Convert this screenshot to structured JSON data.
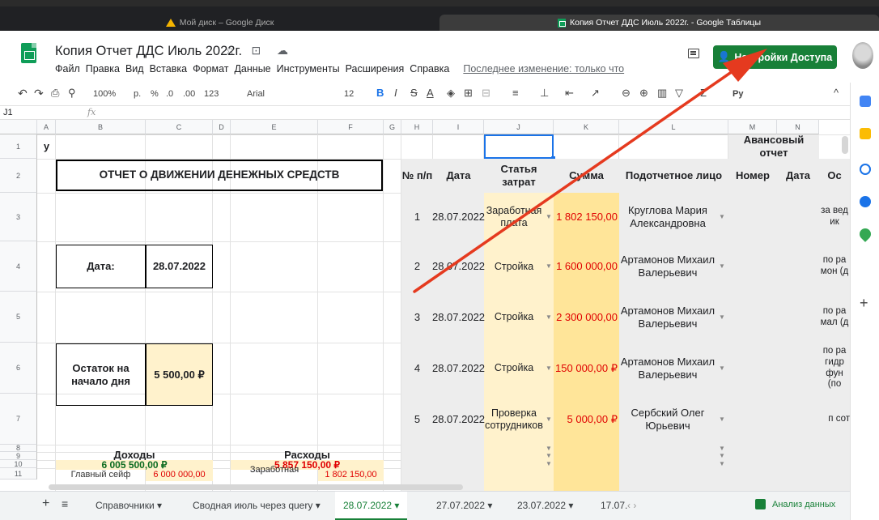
{
  "browser": {
    "tabs": [
      {
        "label": "Мой диск – Google Диск",
        "active": false
      },
      {
        "label": "Копия Отчет ДДС Июль 2022г. - Google Таблицы",
        "active": true
      }
    ]
  },
  "doc": {
    "title": "Копия Отчет ДДС Июль 2022г.",
    "title_icons": "☆ ⊡ ☁",
    "menu": [
      "Файл",
      "Правка",
      "Вид",
      "Вставка",
      "Формат",
      "Данные",
      "Инструменты",
      "Расширения",
      "Справка"
    ],
    "last_edit": "Последнее изменение: только что",
    "share_label": "Настройки Доступа",
    "accent": "#188038"
  },
  "toolbar": {
    "undo": "↶",
    "redo": "↷",
    "print": "⎙",
    "paint": "⚲",
    "zoom": "100%",
    "currency": "р.",
    "percent": "%",
    "dec_less": ".0",
    "dec_more": ".00",
    "format": "123",
    "font": "Arial",
    "size": "12",
    "bold": "B",
    "italic": "I",
    "strike": "S",
    "color": "A",
    "fill": "◈",
    "borders": "⊞",
    "merge": "⊟",
    "halign": "≡",
    "valign": "⊥",
    "wrap": "⇤",
    "rotate": "↗",
    "link": "⊖",
    "comment": "⊕",
    "chart": "▥",
    "filter": "▽",
    "func": "Σ",
    "input": "Pу",
    "collapse": "^"
  },
  "formula": {
    "cell": "J1",
    "fx": "fx"
  },
  "columns": [
    "A",
    "B",
    "C",
    "D",
    "E",
    "F",
    "G",
    "H",
    "I",
    "J",
    "K",
    "L",
    "M",
    "N"
  ],
  "rows": [
    "1",
    "2",
    "3",
    "4",
    "5",
    "6",
    "7",
    "8",
    "9",
    "10",
    "11"
  ],
  "cells": {
    "a1": "у",
    "title": "ОТЧЕТ О ДВИЖЕНИИ ДЕНЕЖНЫХ СРЕДСТВ",
    "date_label": "Дата:",
    "date_value": "28.07.2022",
    "balance_label": "Остаток на начало дня",
    "balance_value": "5 500,00 ₽",
    "income_label": "Доходы",
    "income_value": "6 005 500,00 ₽",
    "expense_label": "Расходы",
    "expense_value": "5 857 150,00 ₽",
    "b11": "Главный сейф",
    "c11": "6 000 000,00",
    "e11": "Заработная",
    "f11": "1 802 150,00",
    "adv_header": "Авансовый отчет"
  },
  "table": {
    "headers": {
      "num": "№ п/п",
      "date": "Дата",
      "article": "Статья затрат",
      "sum": "Сумма",
      "person": "Подотчетное лицо",
      "m": "Номер",
      "n": "Дата",
      "o": "Ос"
    },
    "rows": [
      {
        "num": "1",
        "date": "28.07.2022",
        "article": "Заработная плата",
        "sum": "1 802 150,00",
        "person": "Круглова Мария Александровна",
        "o": "за вед ик"
      },
      {
        "num": "2",
        "date": "28.07.2022",
        "article": "Стройка",
        "sum": "1 600 000,00",
        "person": "Артамонов Михаил Валерьевич",
        "o": "по ра мон (д"
      },
      {
        "num": "3",
        "date": "28.07.2022",
        "article": "Стройка",
        "sum": "2 300 000,00",
        "person": "Артамонов Михаил Валерьевич",
        "o": "по ра мал (д"
      },
      {
        "num": "4",
        "date": "28.07.2022",
        "article": "Стройка",
        "sum": "150 000,00 ₽",
        "person": "Артамонов Михаил Валерьевич",
        "o": "по ра гидр фун (по"
      },
      {
        "num": "5",
        "date": "28.07.2022",
        "article": "Проверка сотрудников",
        "sum": "5 000,00 ₽",
        "person": "Сербский Олег Юрьевич",
        "o": "п сот"
      }
    ]
  },
  "sheets": {
    "add": "+",
    "list": "≡",
    "tabs": [
      "Справочники",
      "Сводная июль через query",
      "28.07.2022",
      "27.07.2022",
      "23.07.2022",
      "17.07."
    ],
    "explore": "Анализ данных",
    "nav": "‹ ›",
    "caret": "▾"
  }
}
